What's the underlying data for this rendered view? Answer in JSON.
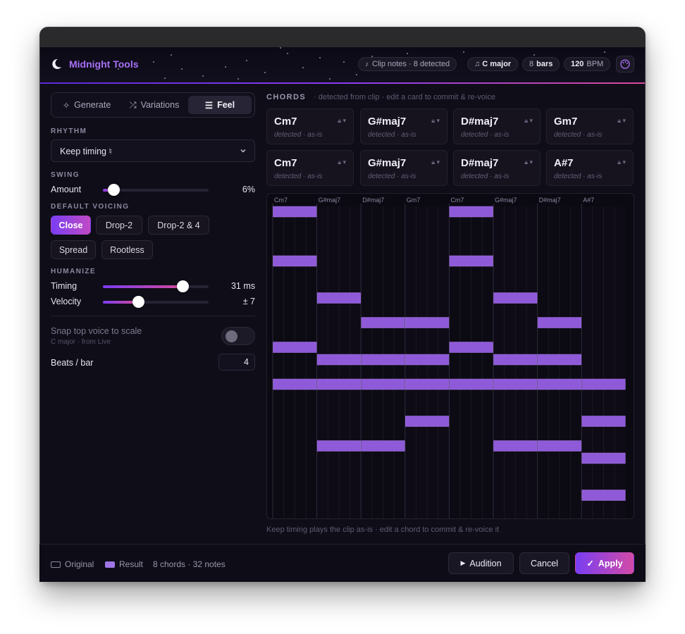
{
  "app": {
    "name": "Midnight Tools"
  },
  "header": {
    "clip_pill": "Clip notes · 8 detected",
    "key_value": "C major",
    "bars_count": "8",
    "bars_unit": "bars",
    "bpm_value": "120",
    "bpm_unit": "BPM"
  },
  "tabs": [
    {
      "label": "Generate"
    },
    {
      "label": "Variations"
    },
    {
      "label": "Feel",
      "active": true
    }
  ],
  "rhythm": {
    "label": "RHYTHM",
    "value": "Keep timing ♮"
  },
  "swing": {
    "label": "SWING",
    "amount_label": "Amount",
    "amount_value": "6%",
    "amount_fraction": 0.06
  },
  "voicing": {
    "label": "DEFAULT VOICING",
    "options": [
      "Close",
      "Drop-2",
      "Drop-2 & 4",
      "Spread",
      "Rootless"
    ],
    "selected": "Close"
  },
  "humanize": {
    "label": "HUMANIZE",
    "timing_label": "Timing",
    "timing_value": "31 ms",
    "timing_fraction": 0.75,
    "velocity_label": "Velocity",
    "velocity_value": "± 7",
    "velocity_fraction": 0.33
  },
  "snap": {
    "label": "Snap top voice to scale",
    "sub": "C major · from Live",
    "enabled": false
  },
  "beats": {
    "label": "Beats / bar",
    "value": "4"
  },
  "chords": {
    "title": "CHORDS",
    "subtitle": "· detected from clip · edit a card to commit & re-voice",
    "cards": [
      {
        "name": "Cm7",
        "sub": "detected · as-is"
      },
      {
        "name": "G#maj7",
        "sub": "detected · as-is"
      },
      {
        "name": "D#maj7",
        "sub": "detected · as-is"
      },
      {
        "name": "Gm7",
        "sub": "detected · as-is"
      },
      {
        "name": "Cm7",
        "sub": "detected · as-is"
      },
      {
        "name": "G#maj7",
        "sub": "detected · as-is"
      },
      {
        "name": "D#maj7",
        "sub": "detected · as-is"
      },
      {
        "name": "A#7",
        "sub": "detected · as-is"
      }
    ]
  },
  "piano_roll": {
    "bar_labels": [
      "Cm7",
      "G#maj7",
      "D#maj7",
      "Gm7",
      "Cm7",
      "G#maj7",
      "D#maj7",
      "A#7"
    ],
    "rows_visible": 25,
    "note_rows": [
      [
        20,
        13,
        10,
        24
      ],
      [
        17,
        10,
        5,
        12
      ],
      [
        12,
        10,
        5,
        15
      ],
      [
        10,
        7,
        12,
        15
      ],
      [
        20,
        13,
        10,
        24
      ],
      [
        17,
        10,
        5,
        12
      ],
      [
        12,
        10,
        5,
        15
      ],
      [
        1,
        4,
        7,
        10
      ]
    ],
    "note_color": "#8f5ad8"
  },
  "caption": "Keep timing plays the clip as-is · edit a chord to commit & re-voice it",
  "footer": {
    "original_label": "Original",
    "result_label": "Result",
    "summary": "8 chords · 32 notes",
    "audition_label": "Audition",
    "cancel_label": "Cancel",
    "apply_label": "Apply"
  },
  "colors": {
    "accent": "#8a3df0",
    "accent_pink": "#d84a9a",
    "note": "#8f5ad8"
  }
}
